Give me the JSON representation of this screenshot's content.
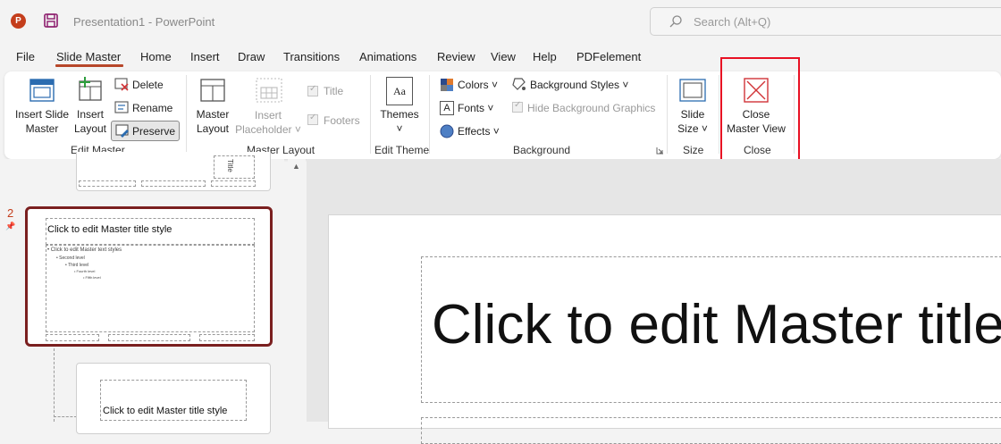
{
  "app": {
    "title": "Presentation1  -  PowerPoint",
    "icon_letter": "P"
  },
  "search": {
    "placeholder": "Search (Alt+Q)"
  },
  "tabs": [
    "File",
    "Slide Master",
    "Home",
    "Insert",
    "Draw",
    "Transitions",
    "Animations",
    "Review",
    "View",
    "Help",
    "PDFelement"
  ],
  "active_tab": "Slide Master",
  "ribbon": {
    "edit_master": {
      "insert_slide_master": [
        "Insert Slide",
        "Master"
      ],
      "insert_layout": [
        "Insert",
        "Layout"
      ],
      "delete": "Delete",
      "rename": "Rename",
      "preserve": "Preserve",
      "label": "Edit Master"
    },
    "master_layout": {
      "master_layout": [
        "Master",
        "Layout"
      ],
      "insert_placeholder": [
        "Insert",
        "Placeholder"
      ],
      "title": "Title",
      "footers": "Footers",
      "label": "Master Layout"
    },
    "edit_theme": {
      "themes": "Themes",
      "label": "Edit Theme"
    },
    "background": {
      "colors": "Colors",
      "fonts": "Fonts",
      "effects": "Effects",
      "background_styles": "Background Styles",
      "hide_background_graphics": "Hide Background Graphics",
      "label": "Background"
    },
    "size": {
      "slide_size": [
        "Slide",
        "Size"
      ],
      "label": "Size"
    },
    "close": {
      "close_master_view": [
        "Close",
        "Master View"
      ],
      "label": "Close"
    }
  },
  "slides": {
    "selected_number": "2",
    "master_title": "Click to edit Master title style",
    "master_text": "Click to edit Master text styles",
    "levels": [
      "Second level",
      "Third level",
      "Fourth level",
      "Fifth level"
    ],
    "thumb1_vertical_text": "Title",
    "thumb3_title": "Click to edit Master title style"
  },
  "canvas": {
    "title": "Click to edit Master title style"
  },
  "colors": {
    "accent": "#b7472a",
    "highlight": "#e81123",
    "selected_border": "#7a1f1f"
  }
}
